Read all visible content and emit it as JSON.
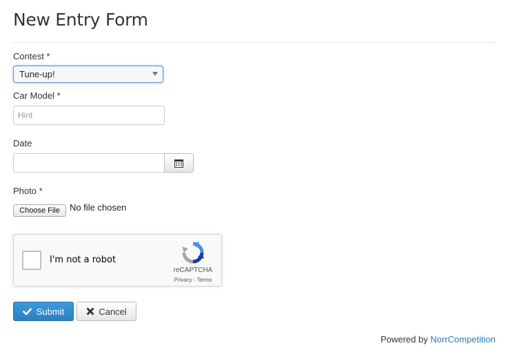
{
  "page": {
    "title": "New Entry Form"
  },
  "form": {
    "contest": {
      "label": "Contest *",
      "selected": "Tune-up!"
    },
    "car_model": {
      "label": "Car Model *",
      "placeholder": "Hint",
      "value": ""
    },
    "date": {
      "label": "Date",
      "value": "",
      "button_icon": "calendar-icon"
    },
    "photo": {
      "label": "Photo *",
      "choose_label": "Choose File",
      "status": "No file chosen"
    },
    "recaptcha": {
      "label": "I'm not a robot",
      "brand": "reCAPTCHA",
      "links": "Privacy - Terms",
      "icon": "recaptcha-logo-icon"
    },
    "actions": {
      "submit_label": "Submit",
      "submit_icon": "checkmark-icon",
      "cancel_label": "Cancel",
      "cancel_icon": "close-icon"
    }
  },
  "footer": {
    "prefix": "Powered by",
    "link_text": "NorrCompetition"
  },
  "colors": {
    "primary_button": "#2b80c2",
    "link": "#2a7ab8",
    "focus_border": "#6a8fd6"
  }
}
